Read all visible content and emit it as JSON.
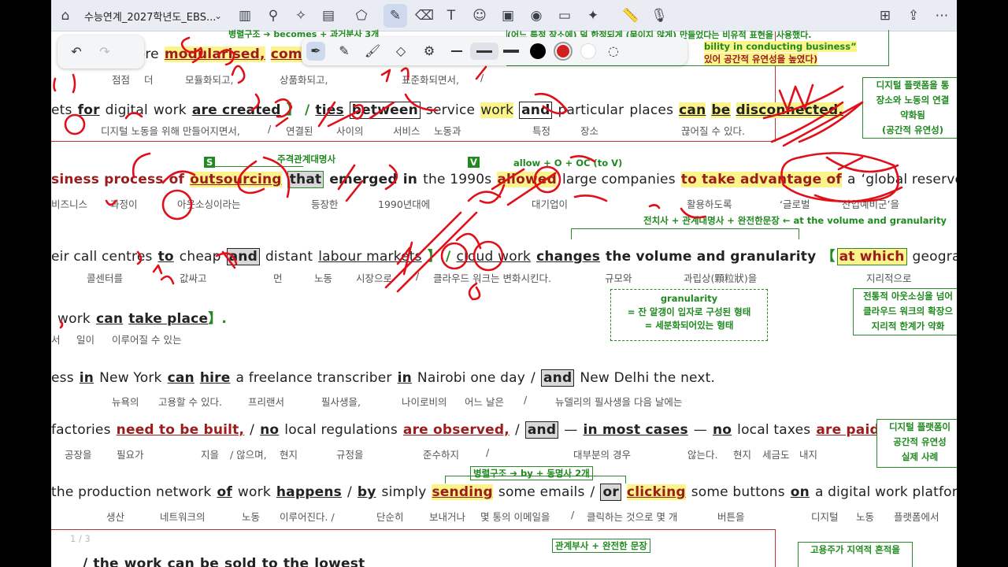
{
  "toolbar": {
    "doc_title": "수능연계_2027학년도_EBS...",
    "icons": [
      "home-icon",
      "chevron-down-icon",
      "sidebar-icon",
      "search-icon",
      "sparkle-icon",
      "document-icon",
      "shapes-icon",
      "pen-icon",
      "eraser-icon",
      "text-icon",
      "sticker-icon",
      "image-icon",
      "camera-icon",
      "comment-icon",
      "laser-icon",
      "ruler-icon",
      "mic-icon",
      "add-page-icon",
      "share-icon",
      "more-icon"
    ]
  },
  "lines": {
    "l1": {
      "w1": "more",
      "w2": "modularised,",
      "w3": "commo"
    },
    "k1": {
      "a": "점점",
      "b": "더",
      "c": "모듈화되고,",
      "d": "상품화되고,",
      "e": "표준화되면서,",
      "f": "/"
    },
    "l2": {
      "w1": "ets",
      "w2": "for",
      "w3": "digital",
      "w4": "work",
      "w5": "are created",
      "w6": "】 /",
      "w7": "ties",
      "w8": "between",
      "w9": "service",
      "w10": "work",
      "w11": "and",
      "w12": "particular",
      "w13": "places",
      "w14": "can",
      "w15": "be",
      "w16": "disconnected."
    },
    "k2": {
      "a": "디지털 노동을 위해 만들어지면서,",
      "b": "/",
      "c": "연결된",
      "d": "사이의",
      "e": "서비스",
      "f": "노동과",
      "g": "특정",
      "h": "장소",
      "i": "끊어질 수 있다."
    },
    "l3": {
      "w1": "siness process",
      "w2": "of",
      "w3": "outsourcing",
      "w4": "that",
      "w5": "emerged",
      "w6": "in",
      "w7": "the 1990s",
      "w8": "allowed",
      "w9": "large companies",
      "w10": "to take advantage of",
      "w11": "a",
      "w12": "‘global reserve army’",
      "w13": "/"
    },
    "k3": {
      "a": "비즈니스",
      "b": "과정이",
      "c": "아웃소싱이라는",
      "d": "등장한",
      "e": "1990년대에",
      "f": "대기업이",
      "g": "활용하도록",
      "h": "‘글로벌",
      "i": "산업예비군’을"
    },
    "l4": {
      "w1": "eir call centres",
      "w2": "to",
      "w3": "cheap",
      "w4": "and",
      "w5": "distant",
      "w6": "labour markets",
      "w7": "】 /",
      "w8": "cloud work",
      "w9": "changes",
      "w10": "the volume and granularity",
      "w11": "【",
      "w12": "at which",
      "w13": "geographically"
    },
    "k4": {
      "a": "콜센터를",
      "b": "값싸고",
      "c": "먼",
      "d": "노동",
      "e": "시장으로",
      "f": "/",
      "g": "클라우드 워크는 변화시킨다.",
      "h": "규모와",
      "i": "과립상(顆粒狀)을",
      "j": "지리적으로"
    },
    "l5": {
      "w1": "work",
      "w2": "can",
      "w3": "take place",
      "w4": "】."
    },
    "k5": {
      "a": "서",
      "b": "일이",
      "c": "이루어질 수 있는"
    },
    "l6": {
      "w1": "ess",
      "w2": "in",
      "w3": "New York",
      "w4": "can",
      "w5": "hire",
      "w6": "a freelance transcriber",
      "w7": "in",
      "w8": "Nairobi one day",
      "w9": "/",
      "w10": "and",
      "w11": "New Delhi the next."
    },
    "k6": {
      "a": "뉴욕의",
      "b": "고용할 수 있다.",
      "c": "프리랜서",
      "d": "필사생을,",
      "e": "나이로비의",
      "f": "어느 날은",
      "g": "/",
      "h": "뉴델리의 필사생을 다음 날에는"
    },
    "l7": {
      "w1": "factories",
      "w2": "need to be built,",
      "w3": "/",
      "w4": "no",
      "w5": "local regulations",
      "w6": "are observed,",
      "w7": "/",
      "w8": "and",
      "w9": "—",
      "w10": "in most cases",
      "w11": "—",
      "w12": "no",
      "w13": "local taxes",
      "w14": "are paid."
    },
    "k7": {
      "a": "공장을",
      "b": "필요가",
      "c": "지을",
      "d": "/ 않으며,",
      "e": "현지",
      "f": "규정을",
      "g": "준수하지",
      "h": "/",
      "i": "대부분의 경우",
      "j": "않는다.",
      "k": "현지",
      "l": "세금도",
      "m": "내지"
    },
    "l8": {
      "w1": "the production network",
      "w2": "of",
      "w3": "work",
      "w4": "happens",
      "w5": "/",
      "w6": "by",
      "w7": "simply",
      "w8": "sending",
      "w9": "some emails",
      "w10": "/",
      "w11": "or",
      "w12": "clicking",
      "w13": "some buttons",
      "w14": "on",
      "w15": "a digital work platform."
    },
    "k8": {
      "a": "생산",
      "b": "네트워크의",
      "c": "노동",
      "d": "이루어진다. /",
      "e": "단순히",
      "f": "보내거나",
      "g": "몇 통의 이메일을",
      "h": "/",
      "i": "클릭하는 것으로 몇 개",
      "j": "버튼을",
      "k": "디지털",
      "l": "노동",
      "m": "플랫폼에서"
    },
    "l9": {
      "w1": "/",
      "w2": "the",
      "w3": "work",
      "w4": "can",
      "w5": "be",
      "w6": "sold",
      "w7": "to",
      "w8": "the",
      "w9": "lowest"
    }
  },
  "annotations": {
    "top_left_green": "병렬구조 ➔ becomes + 과거분사 3개",
    "top_right_green_1": "(어느 특정 장소에) 덜 한정되게 (묶이지 않게) 만들었다는 비유적 표현을 사용했다.",
    "top_right_green_2": "bility in conducting business”",
    "top_right_green_3": "있어 공간적 유연성을 높였다)",
    "s_label": "S",
    "subj_rel": "주격관계대명사",
    "v_label": "V",
    "allow_pattern": "allow + O + OC (to V)",
    "prep_rel": "전치사 + 관계대명사 + 완전한문장 ← at the volume and granularity",
    "granularity_title": "granularity",
    "granularity_1": "= 잔 알갱이 입자로 구성된 형태",
    "granularity_2": "= 세분화되어있는 형태",
    "parallel_by": "병렬구조 ➔ by + 동명사 2개",
    "rel_adverb": "관계부사 + 완전한 문장",
    "page_num": "1 / 3",
    "side_note_1": [
      "디지털 플랫폼을 통",
      "장소와 노동의 연결",
      "약화됨",
      "(공간적 유연성)"
    ],
    "side_note_2": [
      "전통적 아웃소싱을 넘어",
      "클라우드 워크의 확장으",
      "지리적 한계가 약화"
    ],
    "side_note_3": [
      "디지털 플랫폼이",
      "공간적 유연성",
      "실제 사례"
    ],
    "side_note_4": [
      "고용주가 지역적 흔적을"
    ]
  },
  "pen_colors": [
    "#000000",
    "#d21f1f",
    "#ffffff"
  ],
  "accent": "#d21f1f"
}
